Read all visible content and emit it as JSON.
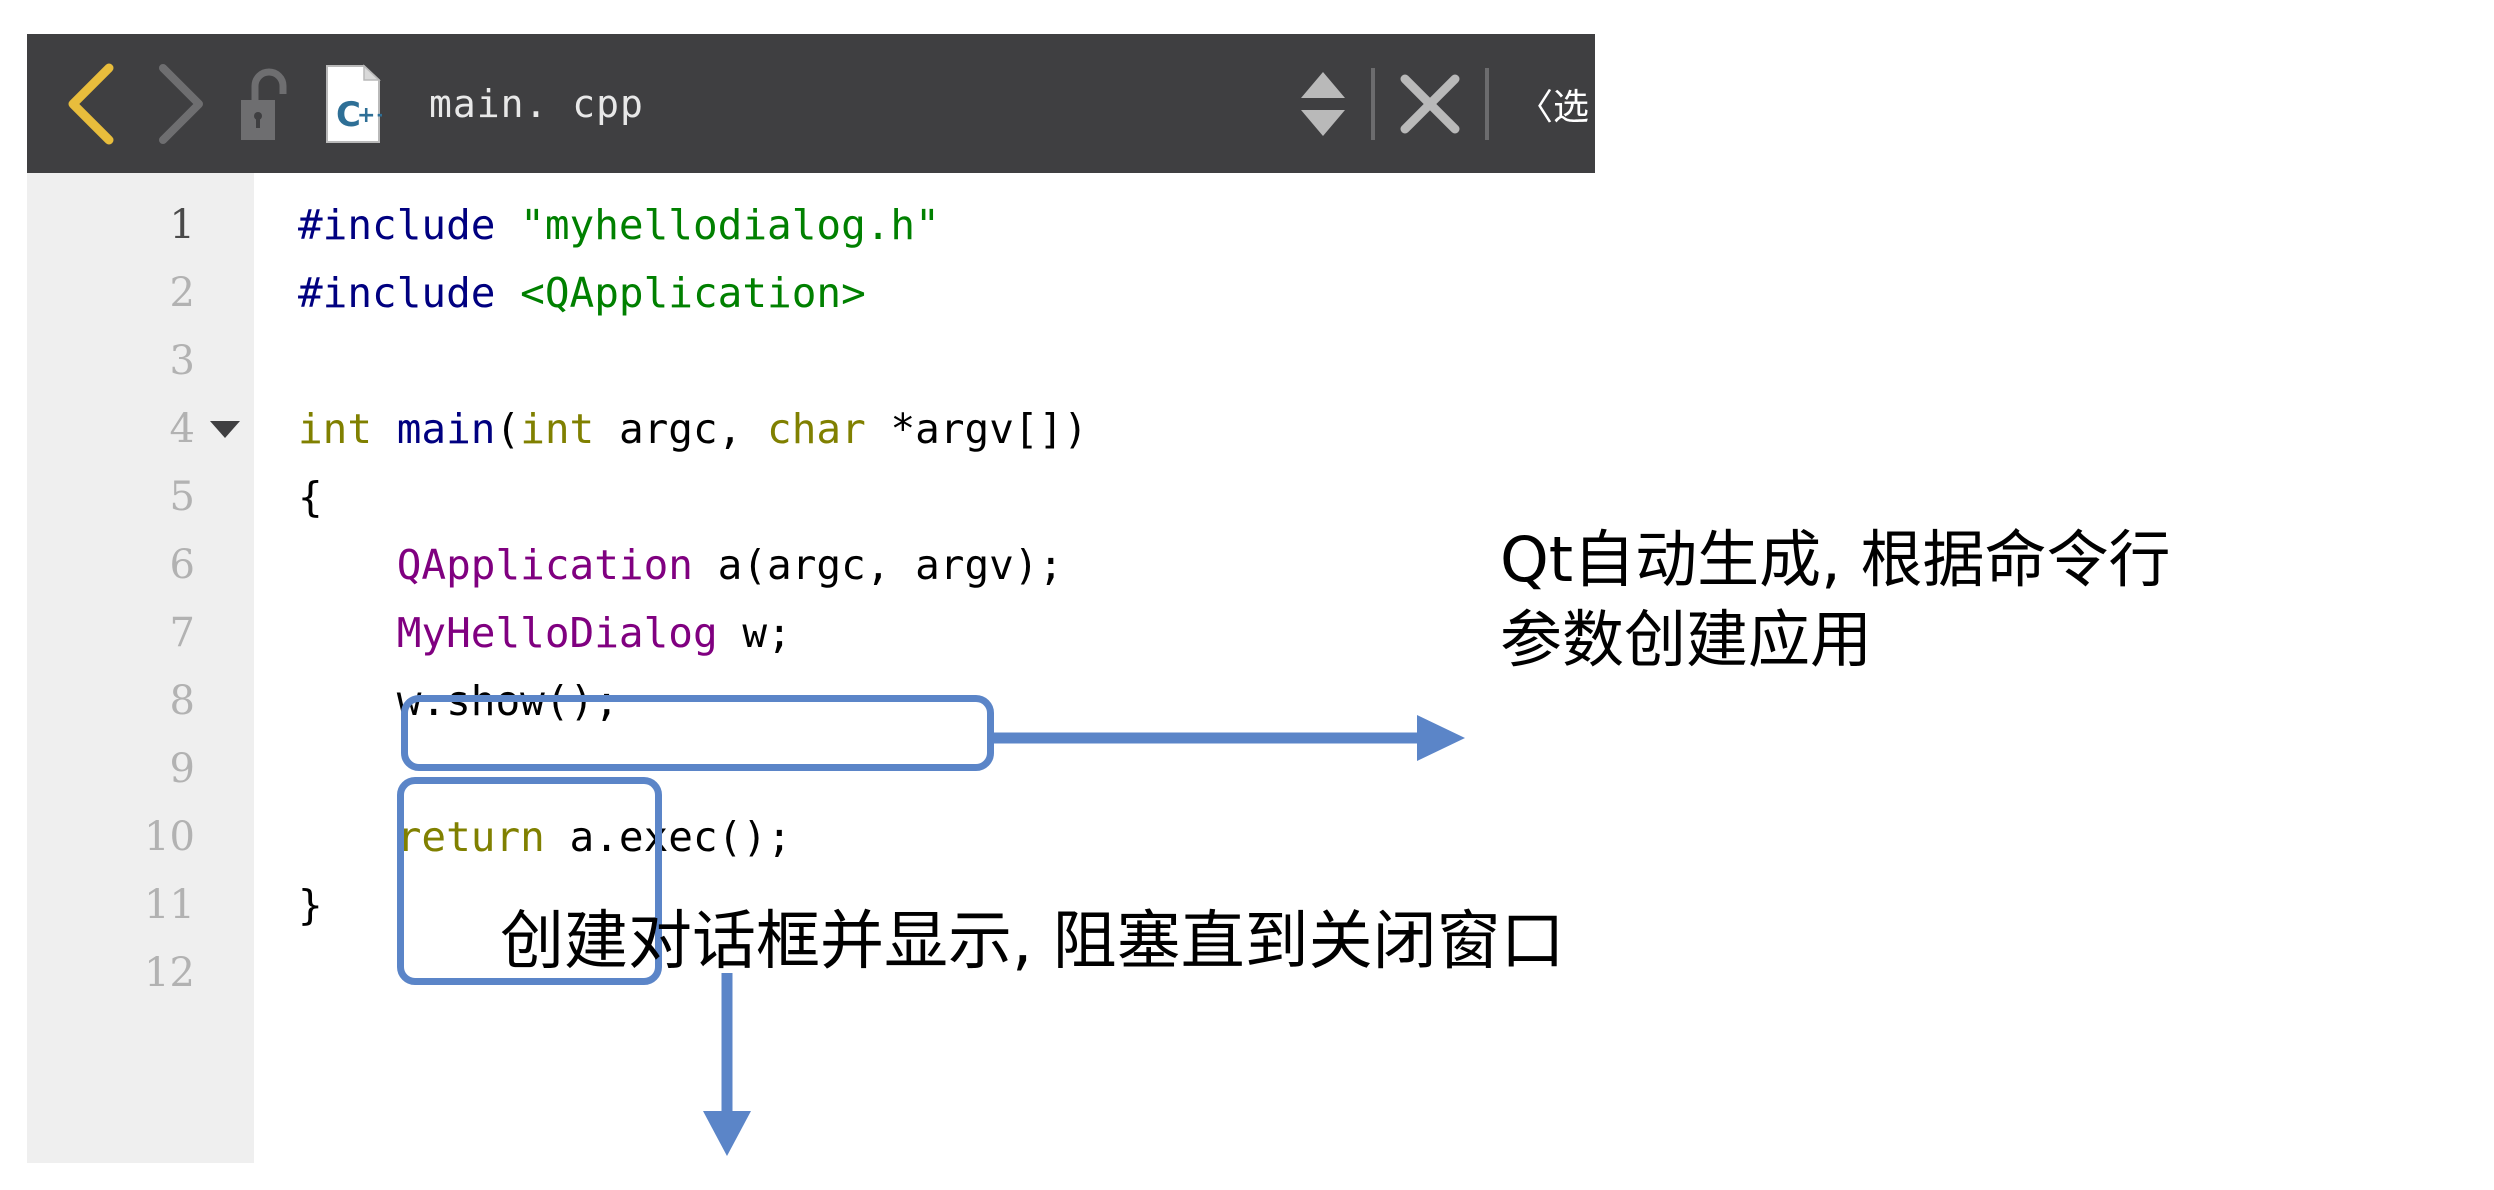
{
  "toolbar": {
    "back_icon": "chevron-left-icon",
    "forward_icon": "chevron-right-icon",
    "lock_icon": "unlocked-padlock-icon",
    "file_type_icon": "cpp-file-icon",
    "file_name": "main. cpp",
    "split_icon": "split-up-down-arrows-icon",
    "close_icon": "close-x-icon",
    "options_label": "〈选",
    "background_color": "#3f3f41",
    "back_icon_color": "#e8bd3c",
    "forward_icon_color": "#6e6e70"
  },
  "editor": {
    "gutter_background": "#efefef",
    "current_line": 1,
    "fold_marker_line": 4,
    "lines": [
      {
        "num": "1",
        "tokens": [
          {
            "t": "#include ",
            "c": "tok-pre"
          },
          {
            "t": "\"myhellodialog.h\"",
            "c": "tok-str"
          }
        ]
      },
      {
        "num": "2",
        "tokens": [
          {
            "t": "#include ",
            "c": "tok-pre"
          },
          {
            "t": "<QApplication>",
            "c": "tok-str"
          }
        ]
      },
      {
        "num": "3",
        "tokens": []
      },
      {
        "num": "4",
        "tokens": [
          {
            "t": "int ",
            "c": "tok-kw"
          },
          {
            "t": "main",
            "c": "tok-fn"
          },
          {
            "t": "(",
            "c": "tok-plain"
          },
          {
            "t": "int ",
            "c": "tok-kw"
          },
          {
            "t": "argc, ",
            "c": "tok-plain"
          },
          {
            "t": "char ",
            "c": "tok-kw"
          },
          {
            "t": "*argv[])",
            "c": "tok-plain"
          }
        ]
      },
      {
        "num": "5",
        "tokens": [
          {
            "t": "{",
            "c": "tok-plain"
          }
        ]
      },
      {
        "num": "6",
        "tokens": [
          {
            "t": "    ",
            "c": "tok-plain"
          },
          {
            "t": "QApplication",
            "c": "tok-type"
          },
          {
            "t": " a(argc, argv);",
            "c": "tok-plain"
          }
        ]
      },
      {
        "num": "7",
        "tokens": [
          {
            "t": "    ",
            "c": "tok-plain"
          },
          {
            "t": "MyHelloDialog",
            "c": "tok-type"
          },
          {
            "t": " w;",
            "c": "tok-plain"
          }
        ]
      },
      {
        "num": "8",
        "tokens": [
          {
            "t": "    w.show();",
            "c": "tok-plain"
          }
        ]
      },
      {
        "num": "9",
        "tokens": []
      },
      {
        "num": "10",
        "tokens": [
          {
            "t": "    ",
            "c": "tok-plain"
          },
          {
            "t": "return",
            "c": "tok-kw"
          },
          {
            "t": " a.exec();",
            "c": "tok-plain"
          }
        ]
      },
      {
        "num": "11",
        "tokens": [
          {
            "t": "}",
            "c": "tok-plain"
          }
        ]
      },
      {
        "num": "12",
        "tokens": []
      }
    ]
  },
  "annotations": {
    "accent_color": "#5b85c8",
    "qapplication_note": "Qt自动生成, 根据命令行\n参数创建应用",
    "dialog_note": "创建对话框并显示, 阻塞直到关闭窗口"
  }
}
